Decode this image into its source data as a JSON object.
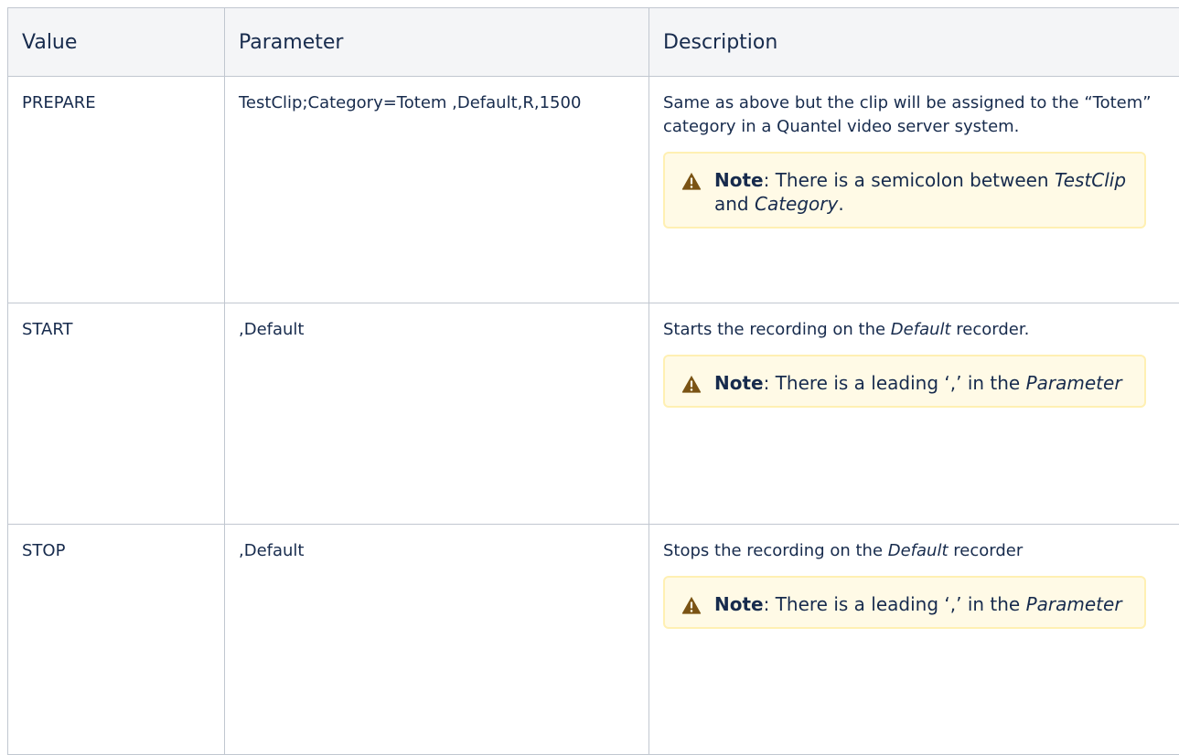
{
  "table": {
    "headers": {
      "value": "Value",
      "parameter": "Parameter",
      "description": "Description"
    },
    "rows": [
      {
        "value": "PREPARE",
        "parameter": "TestClip;Category=Totem ,Default,R,1500",
        "description": "Same as above but the clip will be assigned to the “Totem” category in a Quantel video server system.",
        "note": {
          "label": "Note",
          "text_1": ": There is a semicolon between ",
          "em_1": "TestClip",
          "text_2": " and ",
          "em_2": "Category",
          "text_3": "."
        }
      },
      {
        "value": "START",
        "parameter": ",Default",
        "description_prefix": "Starts the recording on the ",
        "description_em": "Default",
        "description_suffix": " recorder.",
        "note": {
          "label": "Note",
          "text_1": ": There is a leading ‘,’ in the ",
          "em_1": "Parameter"
        }
      },
      {
        "value": "STOP",
        "parameter": ",Default",
        "description_prefix": "Stops the recording on the ",
        "description_em": "Default",
        "description_suffix": " recorder",
        "note": {
          "label": "Note",
          "text_1": ": There is a leading ‘,’ in the ",
          "em_1": "Parameter"
        }
      }
    ]
  },
  "icons": {
    "warning": "warning-icon"
  },
  "colors": {
    "header_bg": "#f4f5f7",
    "border": "#c1c7d0",
    "note_bg": "#fffae6",
    "note_border": "#fff0b3",
    "warning_icon": "#7a5314",
    "text": "#172b4d"
  }
}
